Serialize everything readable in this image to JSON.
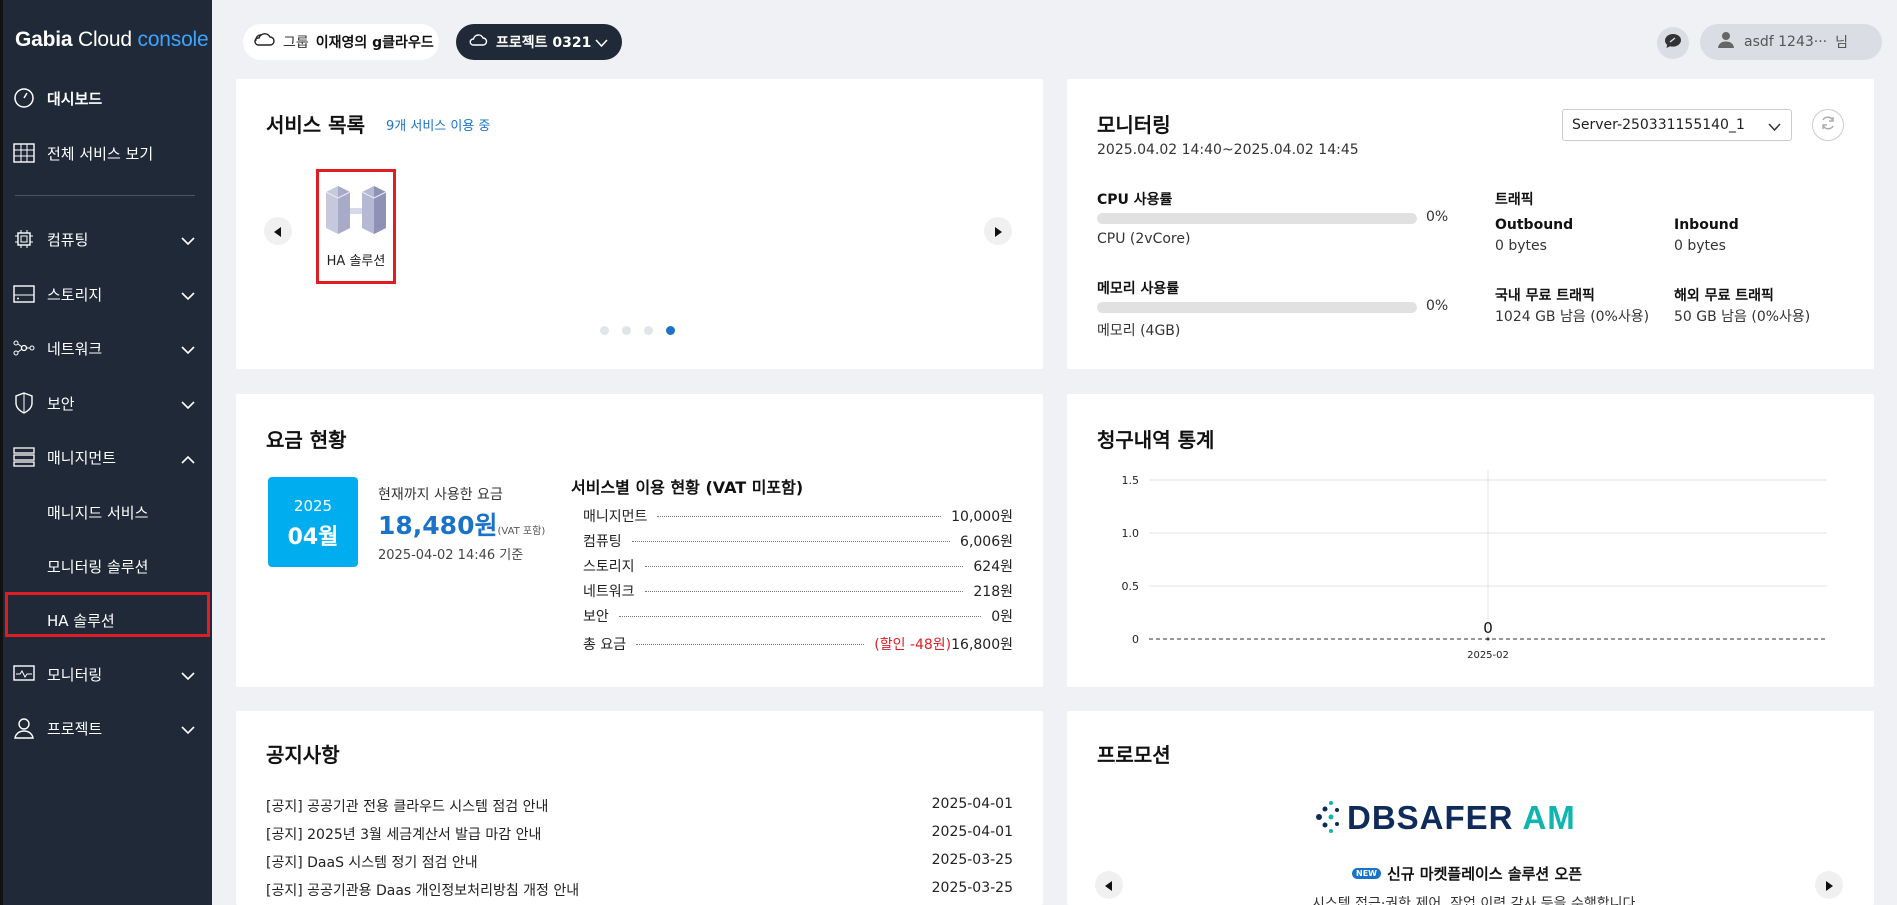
{
  "app": {
    "logo_gabia": "Gabia",
    "logo_cloud": "Cloud",
    "logo_console": "console"
  },
  "sidebar": {
    "items": [
      {
        "label": "대시보드"
      },
      {
        "label": "전체 서비스 보기"
      },
      {
        "label": "컴퓨팅"
      },
      {
        "label": "스토리지"
      },
      {
        "label": "네트워크"
      },
      {
        "label": "보안"
      },
      {
        "label": "매니지먼트"
      },
      {
        "label": "모니터링"
      },
      {
        "label": "프로젝트"
      }
    ],
    "management_sub": [
      "매니지드 서비스",
      "모니터링 솔루션",
      "HA 솔루션"
    ]
  },
  "topbar": {
    "group_label": "그룹",
    "group_value": "이재영의 g클라우드",
    "project_value": "프로젝트 0321",
    "user_name": "asdf 1243···",
    "user_suffix": "님"
  },
  "services": {
    "title": "서비스 목록",
    "count_text": "9개 서비스 이용 중",
    "items": [
      {
        "label": "HA 솔루션"
      }
    ],
    "pages": 4,
    "active_page": 4
  },
  "monitoring": {
    "title": "모니터링",
    "range": "2025.04.02 14:40~2025.04.02 14:45",
    "server": "Server-250331155140_1",
    "cpu_label": "CPU 사용률",
    "cpu_value": "0%",
    "cpu_value_fraction": 0,
    "cpu_spec": "CPU (2vCore)",
    "mem_label": "메모리 사용률",
    "mem_value": "0%",
    "mem_value_fraction": 0,
    "mem_spec": "메모리 (4GB)",
    "traffic_label": "트래픽",
    "outbound_label": "Outbound",
    "outbound_value": "0 bytes",
    "inbound_label": "Inbound",
    "inbound_value": "0 bytes",
    "domestic_label": "국내 무료 트래픽",
    "domestic_value": "1024 GB 남음 (0%사용)",
    "overseas_label": "해외 무료 트래픽",
    "overseas_value": "50 GB 남음 (0%사용)"
  },
  "billing": {
    "title": "요금 현황",
    "year": "2025",
    "month": "04월",
    "used_label": "현재까지 사용한 요금",
    "amount": "18,480원",
    "vat_note": "(VAT 포함)",
    "as_of": "2025-04-02 14:46 기준",
    "usage_title": "서비스별 이용 현황 (VAT 미포함)",
    "rows": [
      {
        "name": "매니지먼트",
        "value": "10,000원"
      },
      {
        "name": "컴퓨팅",
        "value": "6,006원"
      },
      {
        "name": "스토리지",
        "value": "624원"
      },
      {
        "name": "네트워크",
        "value": "218원"
      },
      {
        "name": "보안",
        "value": "0원"
      }
    ],
    "total_label": "총 요금",
    "total_discount": "(할인 -48원)",
    "total_value": "16,800원"
  },
  "chart_data": {
    "type": "line",
    "title": "청구내역 통계",
    "x": [
      "2025-02"
    ],
    "series": [
      {
        "values": [
          0
        ]
      }
    ],
    "data_labels": [
      "0"
    ],
    "yticks": [
      "1.5",
      "1.0",
      "0.5",
      "0"
    ],
    "ylim": [
      0,
      1.5
    ],
    "grid": true
  },
  "notices": {
    "title": "공지사항",
    "items": [
      {
        "text": "[공지] 공공기관 전용 클라우드 시스템 점검 안내",
        "date": "2025-04-01"
      },
      {
        "text": "[공지] 2025년 3월 세금계산서 발급 마감 안내",
        "date": "2025-04-01"
      },
      {
        "text": "[공지] DaaS 시스템 정기 점검 안내",
        "date": "2025-03-25"
      },
      {
        "text": "[공지] 공공기관용 Daas 개인정보처리방침 개정 안내",
        "date": "2025-03-25"
      }
    ]
  },
  "promotion": {
    "title": "프로모션",
    "brand_db": "DBSAFER",
    "brand_am": "AM",
    "new_badge": "NEW",
    "headline": "신규 마켓플레이스 솔루션 오픈",
    "desc": "시스템 접근·권한 제어, 작업 이력 감사 등을 수행합니다."
  },
  "colors": {
    "sidebar_bg": "#1f2937",
    "accent": "#1a73c8",
    "highlight": "#e11d24",
    "month_box": "#00aeef"
  }
}
